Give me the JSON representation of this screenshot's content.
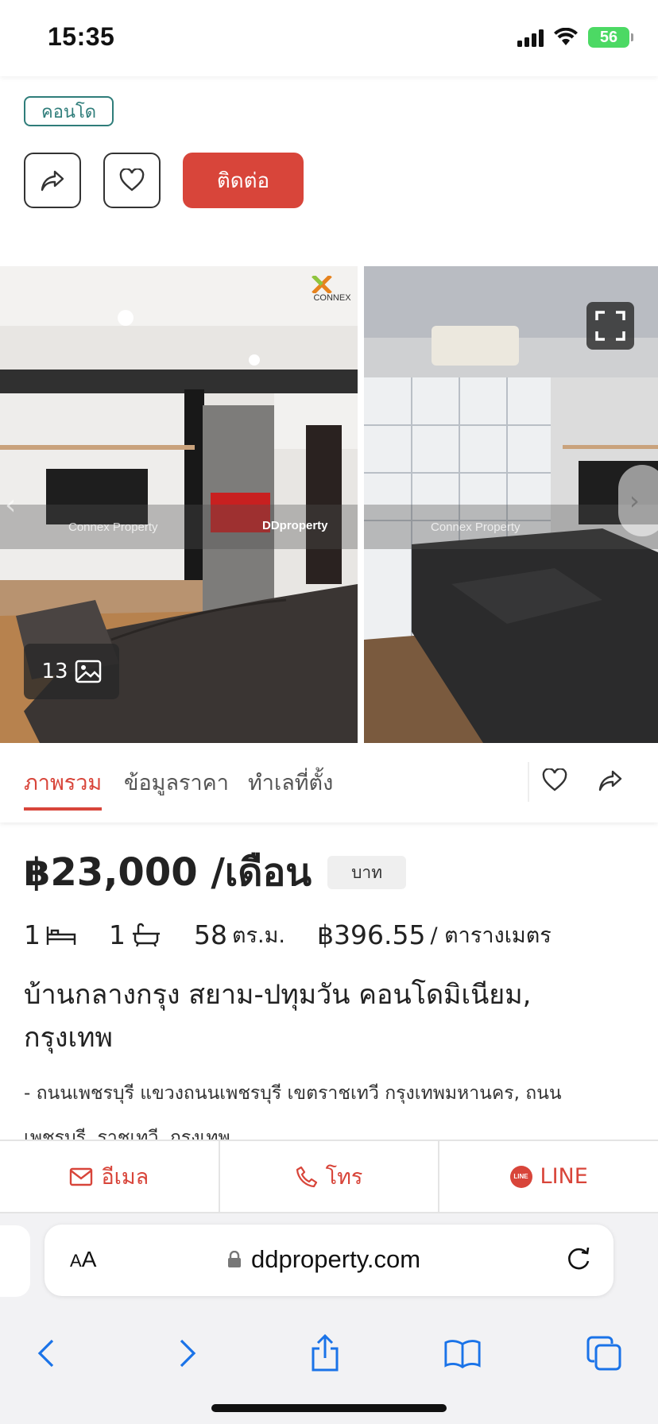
{
  "status_bar": {
    "time": "15:35",
    "battery": "56"
  },
  "header": {
    "type_badge": "คอนโด",
    "contact_button": "ติดต่อ"
  },
  "gallery": {
    "photo_count": "13",
    "watermark_agency": "Connex Property",
    "watermark_brand": "DDproperty",
    "logo_text": "CONNEX"
  },
  "tabs": [
    {
      "label": "ภาพรวม",
      "active": true
    },
    {
      "label": "ข้อมูลราคา",
      "active": false
    },
    {
      "label": "ทำเลที่ตั้ง",
      "active": false
    }
  ],
  "listing": {
    "price": "฿23,000 /เดือน",
    "currency_chip": "บาท",
    "bedrooms": "1",
    "bathrooms": "1",
    "area_value": "58",
    "area_unit": "ตร.ม.",
    "price_per_sqm": "฿396.55",
    "price_per_sqm_unit": "/ ตารางเมตร",
    "title": "บ้านกลางกรุง สยาม-ปทุมวัน คอนโดมิเนียม, กรุงเทพ",
    "address": "- ถนนเพชรบุรี แขวงถนนเพชรบุรี เขตราชเทวี กรุงเทพมหานคร, ถนนเพชรบุรี, ราชเทวี, กรุงเทพ"
  },
  "contact_bar": {
    "email": "อีเมล",
    "phone": "โทร",
    "line": "LINE",
    "line_icon_text": "LINE"
  },
  "browser": {
    "aa_label_small": "A",
    "aa_label_large": "A",
    "url": "ddproperty.com"
  },
  "colors": {
    "accent": "#d8453a",
    "badge": "#2f7d7a"
  }
}
